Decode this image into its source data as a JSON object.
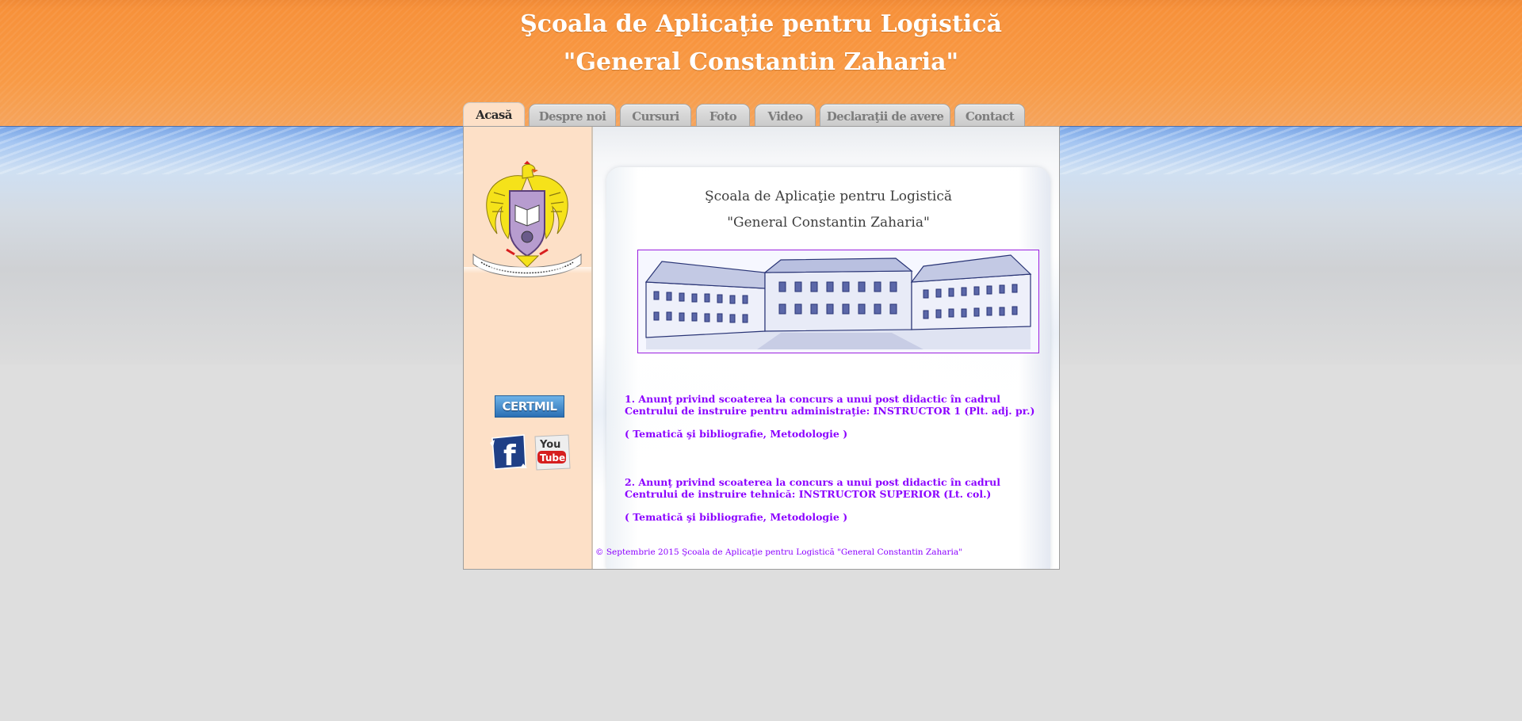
{
  "header": {
    "title_line1": "Şcoala de Aplicaţie pentru Logistică",
    "title_line2": "\"General Constantin Zaharia\""
  },
  "nav": {
    "tabs": [
      {
        "label": "Acasă",
        "active": true
      },
      {
        "label": "Despre noi",
        "active": false
      },
      {
        "label": "Cursuri",
        "active": false
      },
      {
        "label": "Foto",
        "active": false
      },
      {
        "label": "Video",
        "active": false
      },
      {
        "label": "Declaraţii de avere",
        "active": false
      },
      {
        "label": "Contact",
        "active": false
      }
    ]
  },
  "sidebar": {
    "emblem_icon": "school-emblem-icon",
    "certmil_label": "CERTMIL",
    "social": [
      {
        "icon": "facebook-icon",
        "label": "f"
      },
      {
        "icon": "youtube-icon",
        "label_top": "You",
        "label_bottom": "Tube"
      }
    ]
  },
  "main": {
    "title_line1": "Şcoala de Aplicaţie pentru Logistică",
    "title_line2": "\"General Constantin Zaharia\"",
    "announcements": [
      {
        "text": "1. Anunţ privind scoaterea la concurs a unui post didactic în cadrul Centrului de instruire pentru administraţie: INSTRUCTOR 1 (Plt. adj. pr.)",
        "links": "( Tematică şi bibliografie, Metodologie )"
      },
      {
        "text": "2. Anunţ privind scoaterea la concurs a unui post didactic în cadrul Centrului de instruire tehnică: INSTRUCTOR SUPERIOR (Lt. col.)",
        "links": "( Tematică şi bibliografie, Metodologie )"
      }
    ],
    "footer": "© Septembrie 2015 Şcoala de Aplicaţie pentru Logistică \"General Constantin Zaharia\""
  },
  "colors": {
    "header_orange": "#f7913a",
    "accent_purple": "#8b00ff",
    "sidebar_peach": "#fde0c7",
    "page_background": "#dedede"
  }
}
